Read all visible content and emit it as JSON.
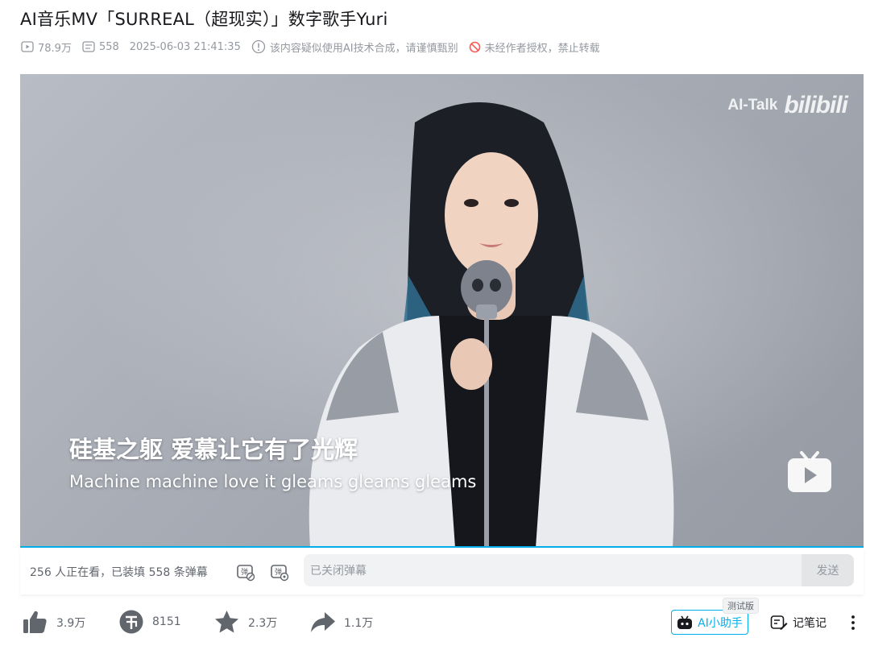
{
  "video": {
    "title": "AI音乐MV「SURREAL（超现实）」数字歌手Yuri",
    "views": "78.9万",
    "danmaku_count": "558",
    "publish_time": "2025-06-03 21:41:35",
    "ai_notice": "该内容疑似使用AI技术合成，请谨慎甄别",
    "copyright_notice": "未经作者授权，禁止转载"
  },
  "player": {
    "watermark_text": "AI-Talk",
    "watermark_logo": "bilibili",
    "subtitle_cn": "硅基之躯 爱慕让它有了光辉",
    "subtitle_en": "Machine machine love it gleams gleams gleams",
    "progress": 0.0
  },
  "danmaku": {
    "info": "256 人正在看，已装填 558 条弹幕",
    "toggle1_icon": "danmaku-off-icon",
    "toggle2_icon": "danmaku-settings-icon",
    "input_placeholder": "已关闭弹幕",
    "send_label": "发送"
  },
  "toolbar": {
    "like_count": "3.9万",
    "coin_count": "8151",
    "favorite_count": "2.3万",
    "share_count": "1.1万",
    "ai_assistant_label": "AI小助手",
    "beta_label": "测试版",
    "notes_label": "记笔记"
  },
  "colors": {
    "accent": "#00aeec",
    "text_primary": "#18191c",
    "text_secondary": "#61666d",
    "text_muted": "#9499a0",
    "forbid_red": "#f85a54"
  }
}
